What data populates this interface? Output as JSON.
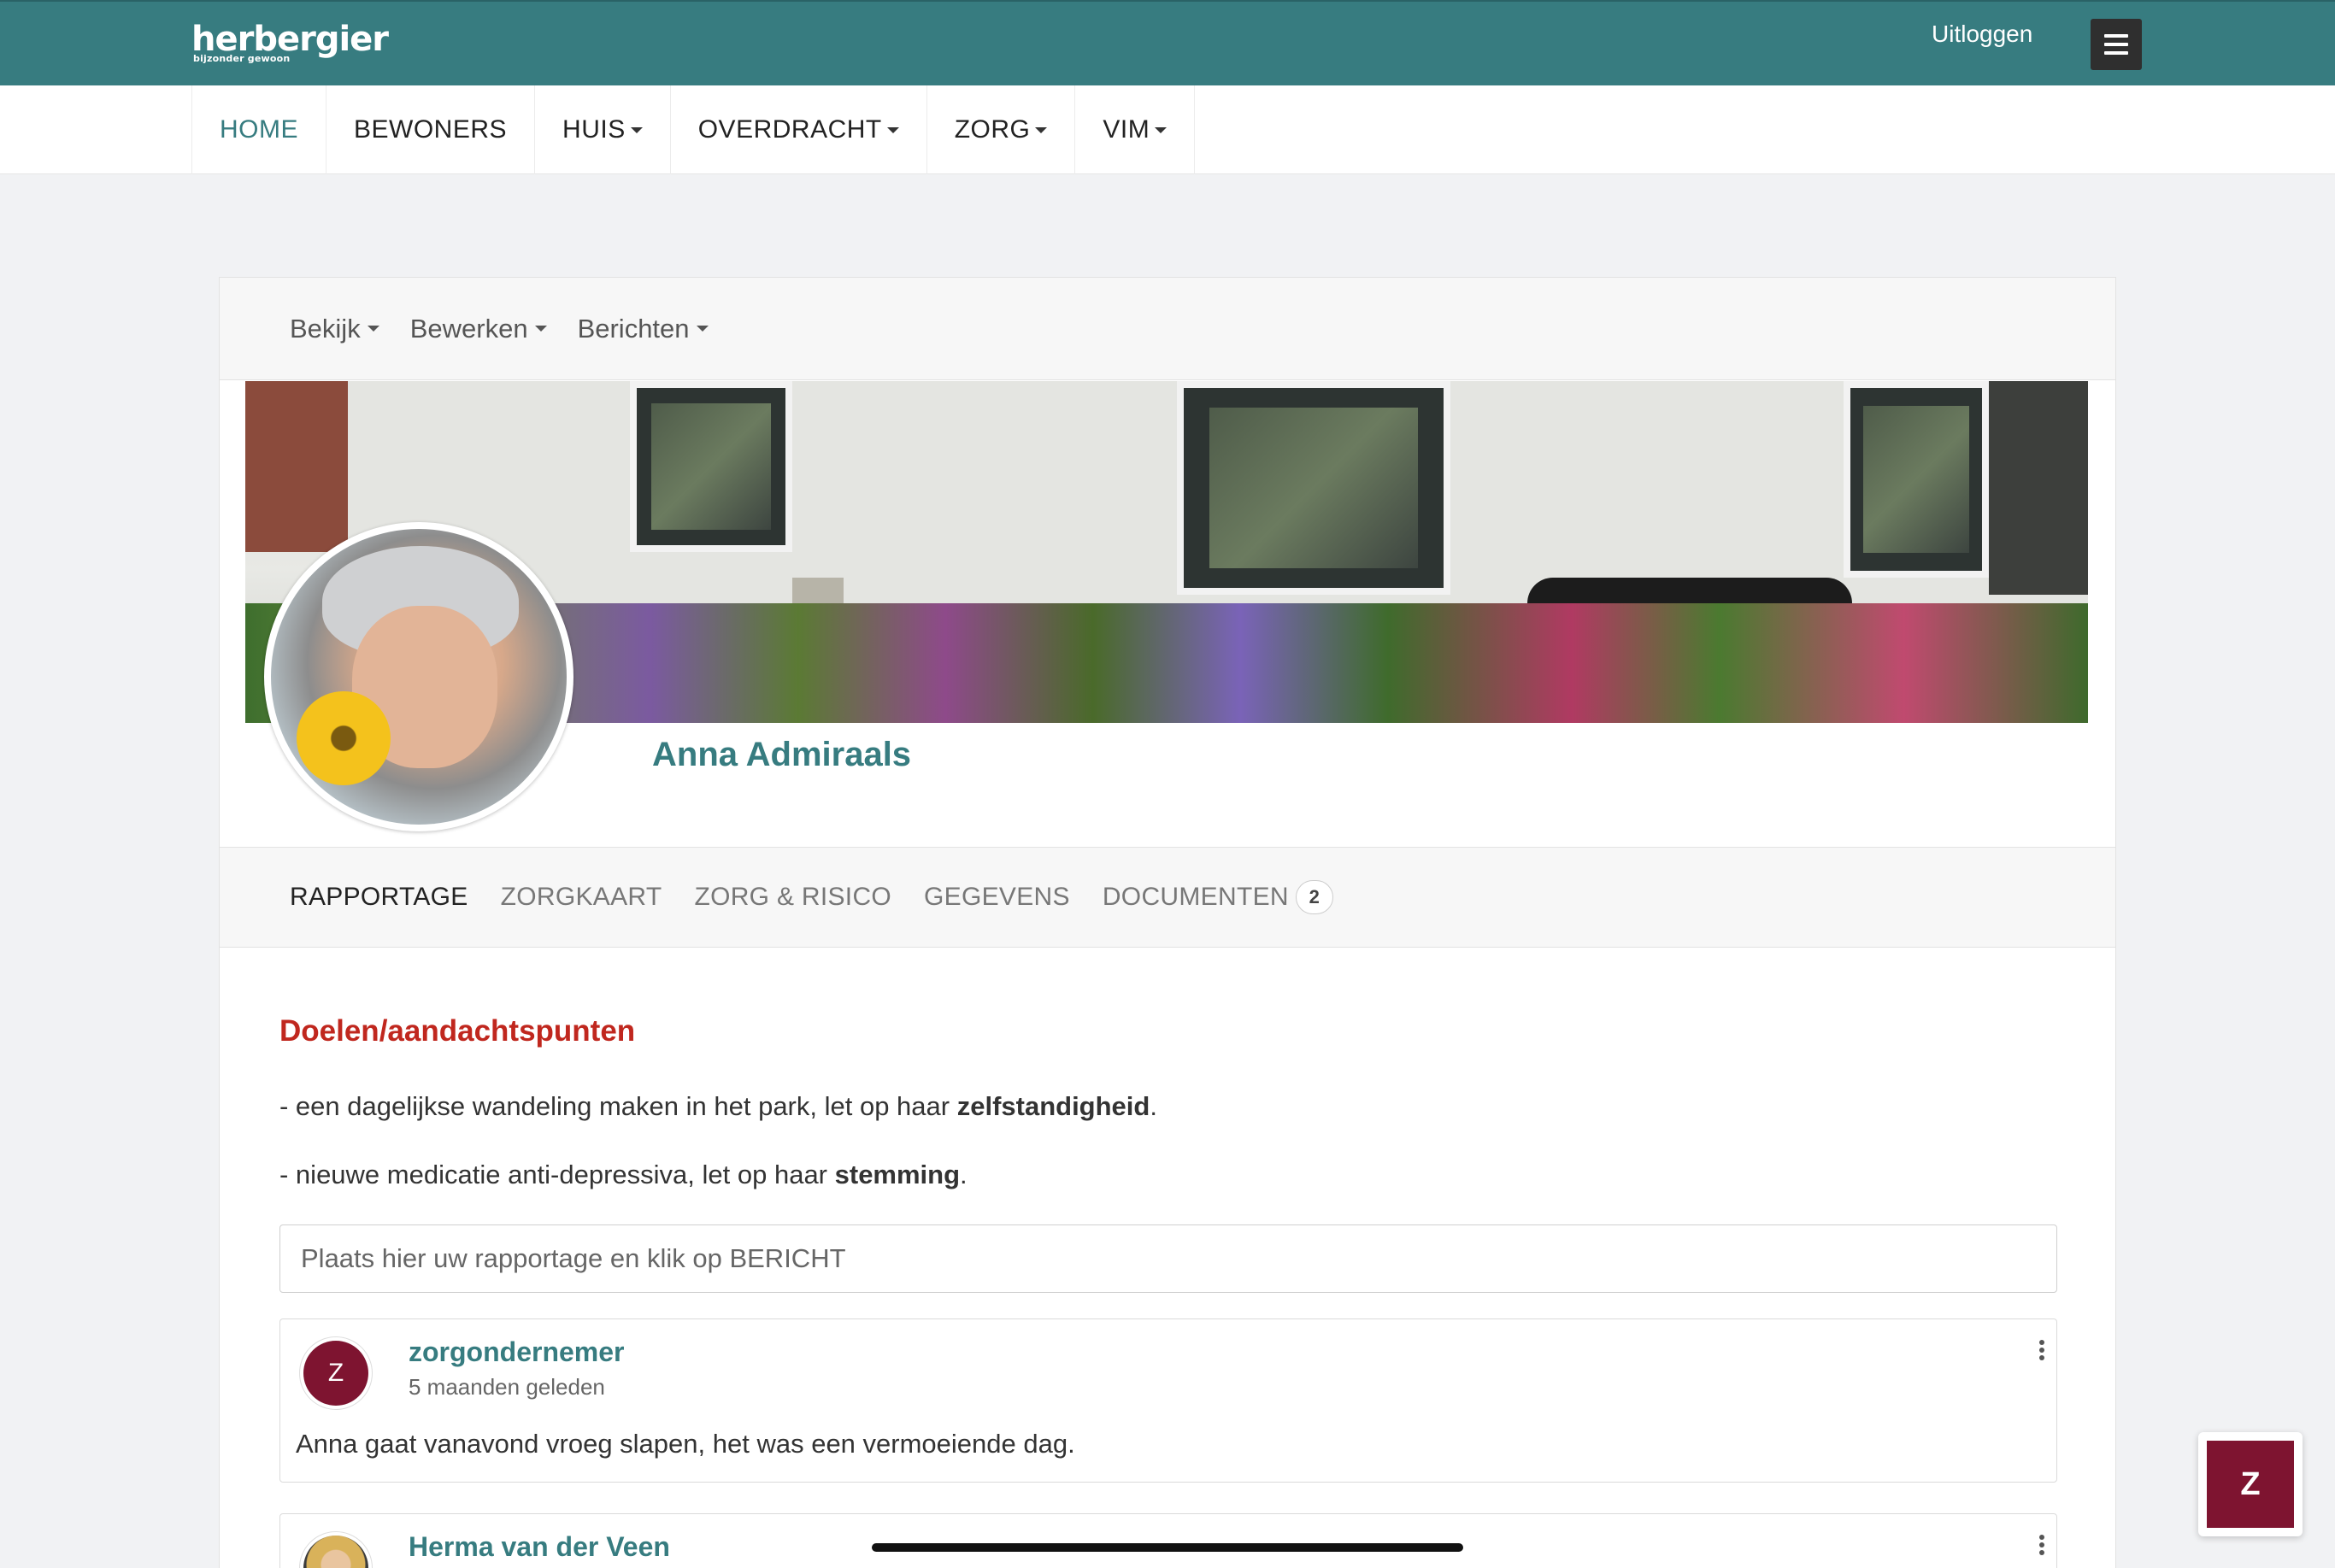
{
  "brand": {
    "name": "herbergier",
    "tagline": "bijzonder gewoon"
  },
  "header": {
    "logout_label": "Uitloggen"
  },
  "main_nav": [
    {
      "label": "HOME",
      "active": true,
      "dropdown": false
    },
    {
      "label": "BEWONERS",
      "active": false,
      "dropdown": false
    },
    {
      "label": "HUIS",
      "active": false,
      "dropdown": true
    },
    {
      "label": "OVERDRACHT",
      "active": false,
      "dropdown": true
    },
    {
      "label": "ZORG",
      "active": false,
      "dropdown": true
    },
    {
      "label": "VIM",
      "active": false,
      "dropdown": true
    }
  ],
  "profile_menu": {
    "view_label": "Bekijk",
    "edit_label": "Bewerken",
    "messages_label": "Berichten"
  },
  "resident": {
    "name": "Anna Admiraals"
  },
  "tabs": {
    "report": "RAPPORTAGE",
    "care_card": "ZORGKAART",
    "care_risk": "ZORG & RISICO",
    "details": "GEGEVENS",
    "documents": "DOCUMENTEN",
    "documents_count": "2"
  },
  "goals": {
    "title": "Doelen/aandachtspunten",
    "items": [
      {
        "prefix": "- een dagelijkse wandeling maken in het park, let op haar ",
        "bold": "zelfstandigheid",
        "suffix": "."
      },
      {
        "prefix": "- nieuwe medicatie anti-depressiva, let op haar ",
        "bold": "stemming",
        "suffix": "."
      }
    ]
  },
  "report_input": {
    "placeholder": "Plaats hier uw rapportage en klik op BERICHT",
    "value": ""
  },
  "posts": [
    {
      "initial": "Z",
      "author": "zorgondernemer",
      "time": "5 maanden geleden",
      "text": "Anna gaat vanavond vroeg slapen, het was een vermoeiende dag."
    },
    {
      "initial": "",
      "author": "Herma van der Veen",
      "time": "",
      "text": ""
    }
  ],
  "chat_button": {
    "initial": "Z"
  },
  "colors": {
    "brand_teal": "#377c80",
    "accent_red": "#c0271e",
    "avatar_maroon": "#7e1430"
  }
}
